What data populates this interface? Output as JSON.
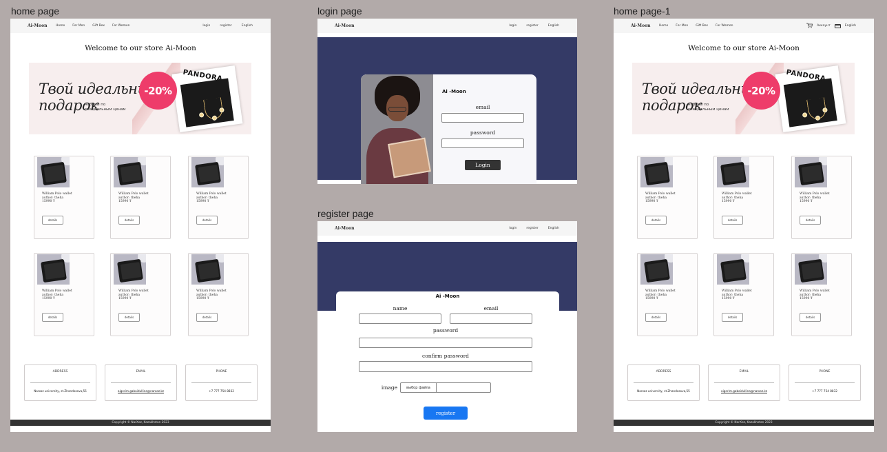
{
  "frames": {
    "home": "home page",
    "login": "login page",
    "register": "register page",
    "home1": "home page-1"
  },
  "nav": {
    "brand": "Ai-Moon",
    "links": [
      "Home",
      "For Men",
      "Gift Box",
      "For Women"
    ],
    "login": "login",
    "register": "register",
    "language": "English"
  },
  "nav_home1": {
    "account": "Аккаунт"
  },
  "home": {
    "welcome": "Welcome to our store Ai-Moon",
    "banner": {
      "script_line1": "Твой идеальный",
      "script_line2": "подарок",
      "sub_line1": "наборы по",
      "sub_line2": "специальным ценам",
      "discount": "-20%",
      "brand": "PANDORA"
    },
    "product": {
      "name_line1": "William Polo wallet",
      "name_line2": "author: theha",
      "price": "15990 ₸",
      "details": "details"
    },
    "footer": {
      "address_label": "ADDRESS",
      "address_value": "Narxoz university, st.Zhandosova,55",
      "email_label": "EMAIL",
      "email_value": "aigerim.gabaidullina@narxoz.kz",
      "phone_label": "PHONE",
      "phone_value": "+7 777 754 8832",
      "copyright": "Copyright © NarXoz, Kazakhstan 2023"
    }
  },
  "login": {
    "brand": "Ai-Moon",
    "title": "Ai -Moon",
    "email_label": "email",
    "password_label": "password",
    "button": "Login"
  },
  "register": {
    "title": "Ai -Moon",
    "name_label": "name",
    "email_label": "email",
    "password_label": "password",
    "confirm_label": "confirm password",
    "image_label": "image",
    "file_button": "выбор файла",
    "button": "register"
  },
  "colors": {
    "canvas": "#b2aaa9",
    "hero": "#343a66",
    "discount": "#ee3c6a",
    "register_button": "#1877f2",
    "login_button": "#333333"
  }
}
